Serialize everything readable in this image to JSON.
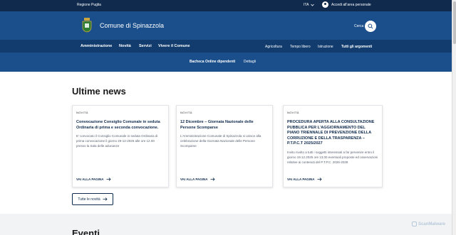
{
  "topbar": {
    "region": "Regione Puglia",
    "lang": "ITA",
    "login": "Accedi all'area personale"
  },
  "header": {
    "title": "Comune di Spinazzola",
    "search_label": "Cerca"
  },
  "nav": {
    "primary": [
      "Amministrazione",
      "Novità",
      "Servizi",
      "Vivere il Comune"
    ],
    "secondary": [
      "Agricoltura",
      "Tempo libero",
      "Istruzione",
      "Tutti gli argomenti"
    ]
  },
  "notice": {
    "title": "Bacheca Online dipendenti",
    "link": "Dettagli"
  },
  "news": {
    "title": "Ultime news",
    "cards": [
      {
        "category": "NOVITÀ",
        "title": "Convocazione Consiglio Comunale in seduta Ordinaria di prima e seconda convocazione.",
        "desc": "E' convocato il Consiglio Comunale in seduta Ordinaria di prima convocazione il giorno 29-12-2025 alle ore 12.00 presso la Sala delle adunanze",
        "link": "VAI ALLA PAGINA"
      },
      {
        "category": "NOVITÀ",
        "title": "12 Dicembre – Giornata Nazionale delle Persone Scomparse",
        "desc": "L'Amministrazione Comunale di Spinazzola si unisce alla celebrazione della Giornata Nazionale delle Persone Scomparse",
        "link": "VAI ALLA PAGINA"
      },
      {
        "category": "NOVITÀ",
        "title": "PROCEDURA APERTA ALLA CONSULTAZIONE PUBBLICA PER L'AGGIORNAMENTO DEL PIANO TRIENNALE DI PREVENZIONE DELLA CORRUZIONE E DELLA TRASPARENZA – P.T.P.C.T 2025/2027",
        "desc": "Invito rivolto a tutti i soggetti interessati a far pervenire entro il giorno 19.12.2025 ore 13,00 eventuali proposte ed osservazioni relative ai contenuti del P.T.P.C. 2026-2028",
        "link": "VAI ALLA PAGINA"
      }
    ],
    "all_button": "Tutte le novità"
  },
  "events": {
    "title": "Eventi"
  },
  "watermark": "ScanMalware",
  "colors": {
    "topbar": "#0f2a4d",
    "header": "#1a4f8b",
    "nav": "#113c6d",
    "accent": "#0f2a4d"
  }
}
